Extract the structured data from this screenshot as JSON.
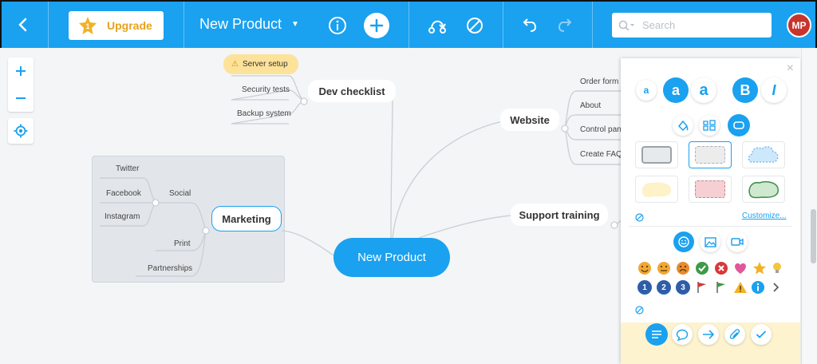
{
  "toolbar": {
    "upgrade_label": "Upgrade",
    "map_title": "New Product",
    "search_placeholder": "Search",
    "avatar_initials": "MP"
  },
  "colors": {
    "accent": "#1aa1ef",
    "upgrade_text": "#e8a21a",
    "avatar_bg": "#c8342c",
    "server_tag_bg": "#fde29a"
  },
  "map": {
    "root": "New Product",
    "dev_checklist": {
      "label": "Dev checklist",
      "children": [
        "Server setup",
        "Security tests",
        "Backup system"
      ]
    },
    "marketing": {
      "label": "Marketing",
      "social": {
        "label": "Social",
        "children": [
          "Twitter",
          "Facebook",
          "Instagram"
        ]
      },
      "print": "Print",
      "partnerships": "Partnerships"
    },
    "website": {
      "label": "Website",
      "children": [
        "Order form",
        "About",
        "Control pan",
        "Create FAQ"
      ]
    },
    "support": {
      "label": "Support training"
    }
  },
  "panel": {
    "customize_label": "Customize...",
    "font_sizes": [
      "a",
      "a",
      "a"
    ],
    "bold_label": "B",
    "italic_label": "I",
    "num_badges": [
      "1",
      "2",
      "3"
    ]
  }
}
